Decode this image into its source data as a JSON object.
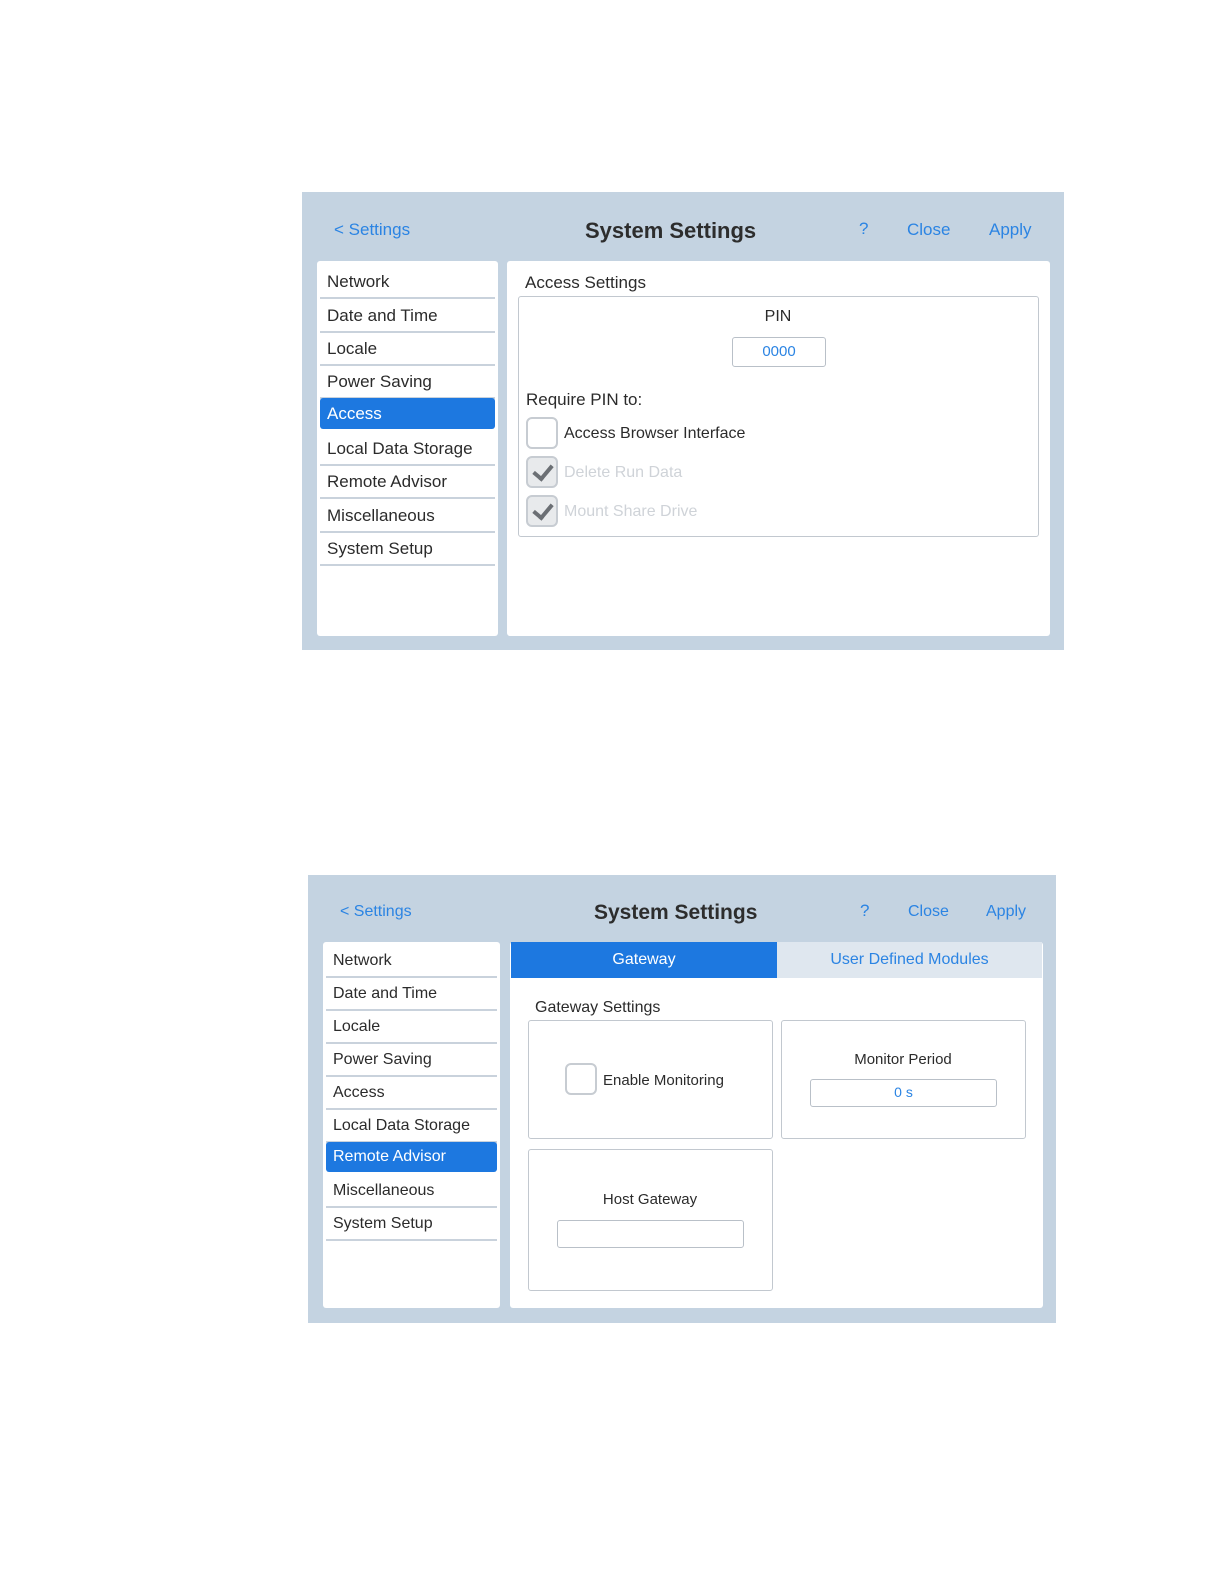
{
  "screen1": {
    "header": {
      "back_label": "< Settings",
      "title": "System Settings",
      "help_label": "?",
      "close_label": "Close",
      "apply_label": "Apply"
    },
    "sidebar": {
      "items": [
        {
          "label": "Network",
          "active": false
        },
        {
          "label": "Date and Time",
          "active": false
        },
        {
          "label": "Locale",
          "active": false
        },
        {
          "label": "Power Saving",
          "active": false
        },
        {
          "label": "Access",
          "active": true
        },
        {
          "label": "Local Data Storage",
          "active": false
        },
        {
          "label": "Remote Advisor",
          "active": false
        },
        {
          "label": "Miscellaneous",
          "active": false
        },
        {
          "label": "System Setup",
          "active": false
        }
      ]
    },
    "content": {
      "section_title": "Access Settings",
      "pin_label": "PIN",
      "pin_value": "0000",
      "require_label": "Require PIN to:",
      "options": [
        {
          "label": "Access Browser Interface",
          "checked": false,
          "disabled": false
        },
        {
          "label": "Delete Run Data",
          "checked": true,
          "disabled": true
        },
        {
          "label": "Mount Share Drive",
          "checked": true,
          "disabled": true
        }
      ]
    }
  },
  "screen2": {
    "header": {
      "back_label": "< Settings",
      "title": "System Settings",
      "help_label": "?",
      "close_label": "Close",
      "apply_label": "Apply"
    },
    "sidebar": {
      "items": [
        {
          "label": "Network",
          "active": false
        },
        {
          "label": "Date and Time",
          "active": false
        },
        {
          "label": "Locale",
          "active": false
        },
        {
          "label": "Power Saving",
          "active": false
        },
        {
          "label": "Access",
          "active": false
        },
        {
          "label": "Local Data Storage",
          "active": false
        },
        {
          "label": "Remote Advisor",
          "active": true
        },
        {
          "label": "Miscellaneous",
          "active": false
        },
        {
          "label": "System Setup",
          "active": false
        }
      ]
    },
    "tabs": [
      {
        "label": "Gateway",
        "active": true
      },
      {
        "label": "User Defined Modules",
        "active": false
      }
    ],
    "content": {
      "section_title": "Gateway Settings",
      "enable_monitoring_label": "Enable Monitoring",
      "enable_monitoring_checked": false,
      "monitor_period_label": "Monitor Period",
      "monitor_period_value": "0 s",
      "host_gateway_label": "Host Gateway",
      "host_gateway_value": ""
    }
  }
}
